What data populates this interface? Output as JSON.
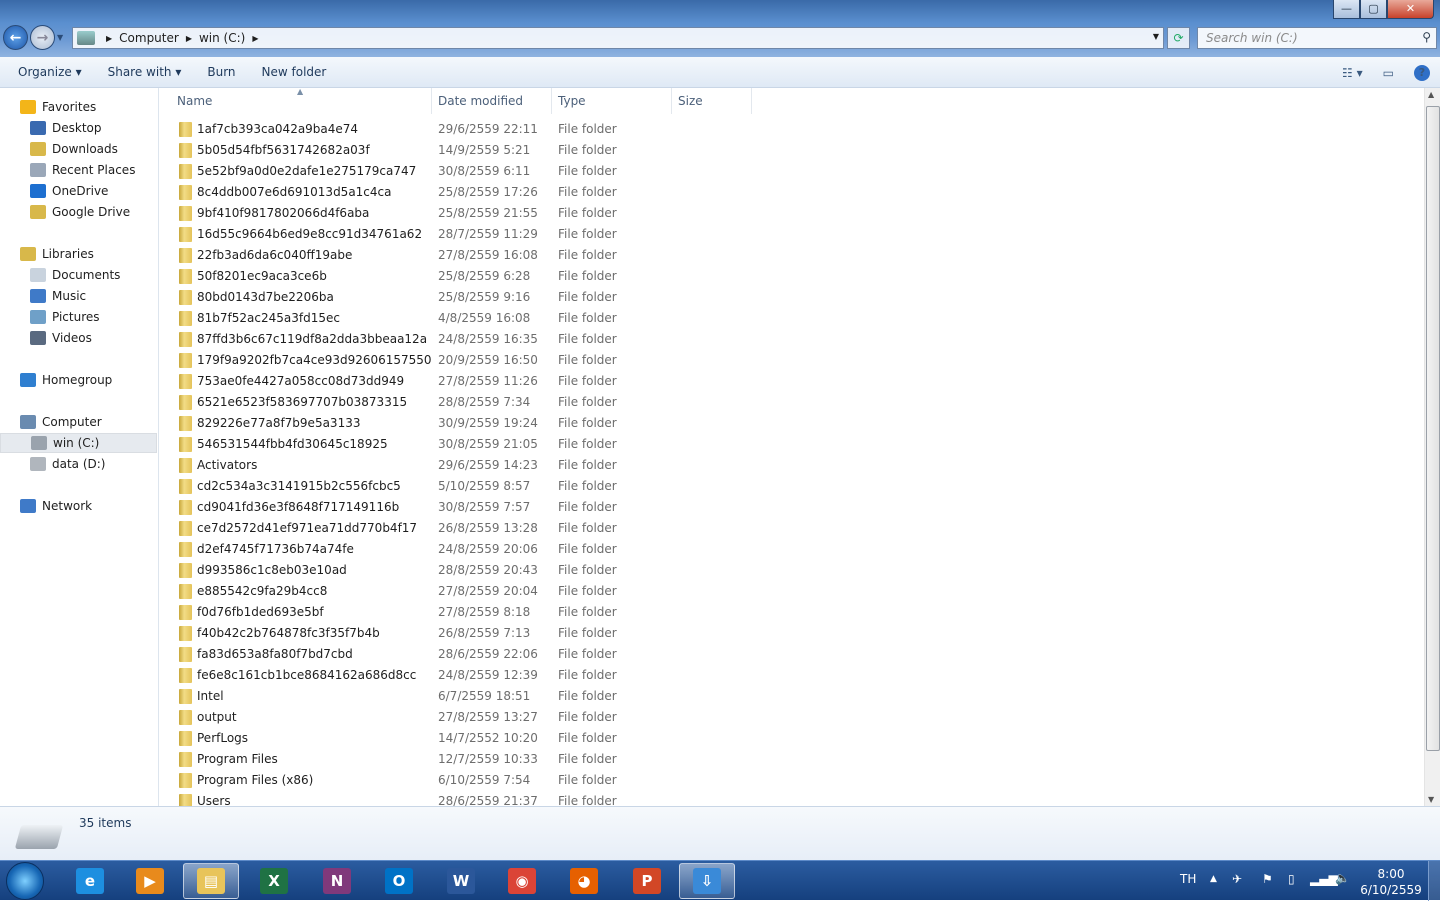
{
  "window": {
    "minimize": "—",
    "maximize": "▢",
    "close": "✕"
  },
  "address": {
    "crumbs": [
      "Computer",
      "win (C:)"
    ],
    "search_placeholder": "Search win (C:)"
  },
  "toolbar": {
    "organize": "Organize ▾",
    "share_with": "Share with ▾",
    "burn": "Burn",
    "new_folder": "New folder",
    "views": "☷ ▾",
    "preview": "▭",
    "help": "?"
  },
  "sidebar": {
    "items": [
      {
        "label": "Favorites",
        "group": true,
        "color": "#f3b519"
      },
      {
        "label": "Desktop",
        "color": "#3a6ab0"
      },
      {
        "label": "Downloads",
        "color": "#d8b84a"
      },
      {
        "label": "Recent Places",
        "color": "#9aa7b8"
      },
      {
        "label": "OneDrive",
        "color": "#1d6fd0"
      },
      {
        "label": "Google Drive",
        "color": "#d8b84a"
      },
      {
        "label": "Libraries",
        "group": true,
        "color": "#d8b84a"
      },
      {
        "label": "Documents",
        "color": "#c9d3de"
      },
      {
        "label": "Music",
        "color": "#3f7ac8"
      },
      {
        "label": "Pictures",
        "color": "#6fa0c8"
      },
      {
        "label": "Videos",
        "color": "#5a6a80"
      },
      {
        "label": "Homegroup",
        "group": true,
        "color": "#2f7fd0"
      },
      {
        "label": "Computer",
        "group": true,
        "color": "#6a8bb0"
      },
      {
        "label": "win (C:)",
        "selected": true,
        "color": "#9aa3ad"
      },
      {
        "label": "data (D:)",
        "color": "#b0b6bd"
      },
      {
        "label": "Network",
        "group": true,
        "color": "#3f7ac8"
      }
    ]
  },
  "columns": {
    "name": "Name",
    "date": "Date modified",
    "type": "Type",
    "size": "Size"
  },
  "files": [
    [
      "1af7cb393ca042a9ba4e74",
      "29/6/2559 22:11"
    ],
    [
      "5b05d54fbf5631742682a03f",
      "14/9/2559 5:21"
    ],
    [
      "5e52bf9a0d0e2dafe1e275179ca747",
      "30/8/2559 6:11"
    ],
    [
      "8c4ddb007e6d691013d5a1c4ca",
      "25/8/2559 17:26"
    ],
    [
      "9bf410f9817802066d4f6aba",
      "25/8/2559 21:55"
    ],
    [
      "16d55c9664b6ed9e8cc91d34761a62",
      "28/7/2559 11:29"
    ],
    [
      "22fb3ad6da6c040ff19abe",
      "27/8/2559 16:08"
    ],
    [
      "50f8201ec9aca3ce6b",
      "25/8/2559 6:28"
    ],
    [
      "80bd0143d7be2206ba",
      "25/8/2559 9:16"
    ],
    [
      "81b7f52ac245a3fd15ec",
      "4/8/2559 16:08"
    ],
    [
      "87ffd3b6c67c119df8a2dda3bbeaa12a",
      "24/8/2559 16:35"
    ],
    [
      "179f9a9202fb7ca4ce93d92606157550",
      "20/9/2559 16:50"
    ],
    [
      "753ae0fe4427a058cc08d73dd949",
      "27/8/2559 11:26"
    ],
    [
      "6521e6523f583697707b03873315",
      "28/8/2559 7:34"
    ],
    [
      "829226e77a8f7b9e5a3133",
      "30/9/2559 19:24"
    ],
    [
      "546531544fbb4fd30645c18925",
      "30/8/2559 21:05"
    ],
    [
      "Activators",
      "29/6/2559 14:23"
    ],
    [
      "cd2c534a3c3141915b2c556fcbc5",
      "5/10/2559 8:57"
    ],
    [
      "cd9041fd36e3f8648f717149116b",
      "30/8/2559 7:57"
    ],
    [
      "ce7d2572d41ef971ea71dd770b4f17",
      "26/8/2559 13:28"
    ],
    [
      "d2ef4745f71736b74a74fe",
      "24/8/2559 20:06"
    ],
    [
      "d993586c1c8eb03e10ad",
      "28/8/2559 20:43"
    ],
    [
      "e885542c9fa29b4cc8",
      "27/8/2559 20:04"
    ],
    [
      "f0d76fb1ded693e5bf",
      "27/8/2559 8:18"
    ],
    [
      "f40b42c2b764878fc3f35f7b4b",
      "26/8/2559 7:13"
    ],
    [
      "fa83d653a8fa80f7bd7cbd",
      "28/6/2559 22:06"
    ],
    [
      "fe6e8c161cb1bce8684162a686d8cc",
      "24/8/2559 12:39"
    ],
    [
      "Intel",
      "6/7/2559 18:51"
    ],
    [
      "output",
      "27/8/2559 13:27"
    ],
    [
      "PerfLogs",
      "14/7/2552 10:20"
    ],
    [
      "Program Files",
      "12/7/2559 10:33"
    ],
    [
      "Program Files (x86)",
      "6/10/2559 7:54"
    ],
    [
      "Users",
      "28/6/2559 21:37"
    ]
  ],
  "file_type": "File folder",
  "status": {
    "count": "35 items"
  },
  "taskbar": {
    "apps": [
      {
        "name": "internet-explorer",
        "glyph": "e",
        "color": "#1d8fe0"
      },
      {
        "name": "media-player",
        "glyph": "▶",
        "color": "#e88a1c"
      },
      {
        "name": "file-explorer",
        "glyph": "▤",
        "color": "#e8c45a",
        "active": true
      },
      {
        "name": "excel",
        "glyph": "X",
        "color": "#1f7244"
      },
      {
        "name": "onenote",
        "glyph": "N",
        "color": "#80397b"
      },
      {
        "name": "outlook",
        "glyph": "O",
        "color": "#0072c6"
      },
      {
        "name": "word",
        "glyph": "W",
        "color": "#2b579a"
      },
      {
        "name": "chrome",
        "glyph": "◉",
        "color": "#db4437"
      },
      {
        "name": "firefox",
        "glyph": "◕",
        "color": "#e66000"
      },
      {
        "name": "powerpoint",
        "glyph": "P",
        "color": "#d24726"
      },
      {
        "name": "download-manager",
        "glyph": "⇩",
        "color": "#3a8ad8",
        "active": true
      }
    ],
    "lang": "TH",
    "time": "8:00",
    "date": "6/10/2559"
  }
}
